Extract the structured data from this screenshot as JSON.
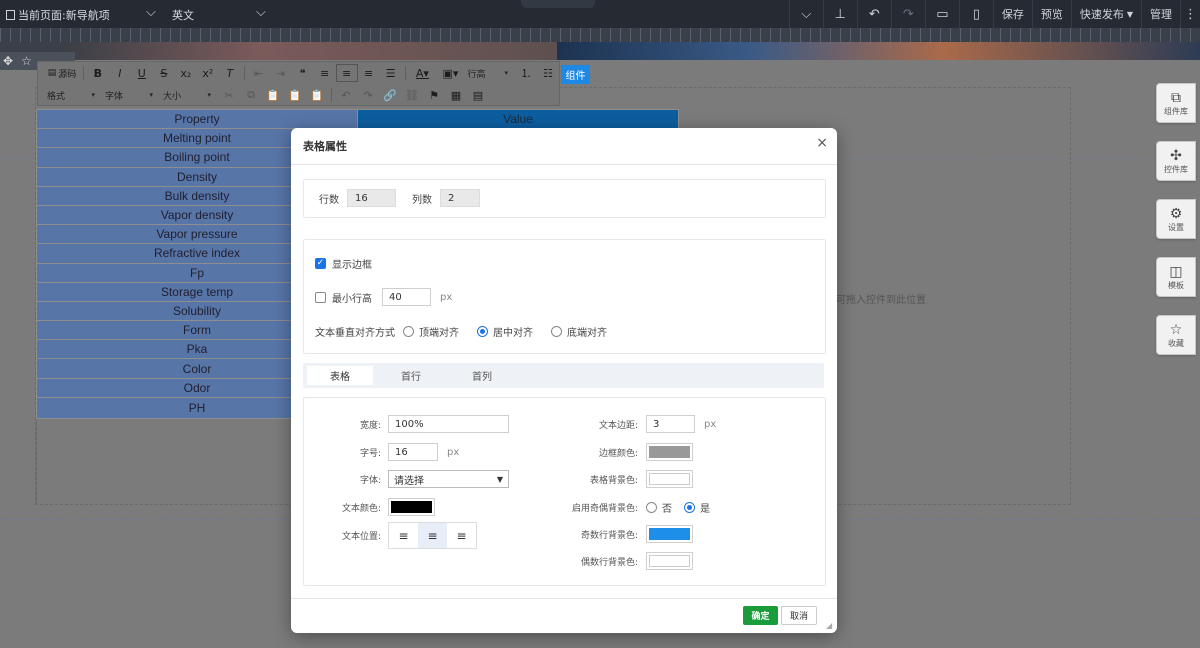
{
  "topbar": {
    "current_page": "当前页面:新导航项",
    "language": "英文",
    "buttons": {
      "save": "保存",
      "preview": "预览",
      "quick_publish": "快速发布",
      "manage": "管理"
    },
    "icons": [
      "chevron-down-icon",
      "align-bottom-icon",
      "undo-icon",
      "redo-icon",
      "desktop-icon",
      "mobile-icon"
    ]
  },
  "canvas": {
    "drop_hint": "可拖入控件到此位置",
    "add_component_label": "组件"
  },
  "editor_toolbar": {
    "source_label": "源码",
    "line_height_combo": "行高",
    "format_combo": "格式",
    "font_combo": "字体",
    "size_combo": "大小"
  },
  "table": {
    "header": [
      "Property",
      "Value"
    ],
    "rows": [
      "Melting point",
      "Boiling point",
      "Density",
      "Bulk density",
      "Vapor density",
      "Vapor pressure",
      "Refractive index",
      "Fp",
      "Storage temp",
      "Solubility",
      "Form",
      "Pka",
      "Color",
      "Odor",
      "PH"
    ]
  },
  "right_panel": [
    {
      "label": "组件库",
      "icon": "copy-icon"
    },
    {
      "label": "控件库",
      "icon": "puzzle-icon"
    },
    {
      "label": "设置",
      "icon": "gear-icon"
    },
    {
      "label": "模板",
      "icon": "layout-icon"
    },
    {
      "label": "收藏",
      "icon": "star-icon"
    }
  ],
  "modal": {
    "title": "表格属性",
    "rows_label": "行数",
    "rows_value": "16",
    "cols_label": "列数",
    "cols_value": "2",
    "show_border_label": "显示边框",
    "show_border_checked": true,
    "min_row_height_label": "最小行高",
    "min_row_height_checked": false,
    "min_row_height_value": "40",
    "px": "px",
    "valign_label": "文本垂直对齐方式",
    "valign_options": [
      "顶端对齐",
      "居中对齐",
      "底端对齐"
    ],
    "valign_selected": "居中对齐",
    "tabs": [
      "表格",
      "首行",
      "首列"
    ],
    "active_tab": "表格",
    "width_label": "宽度:",
    "width_value": "100%",
    "font_size_label": "字号:",
    "font_size_value": "16",
    "font_label": "字体:",
    "font_value": "请选择",
    "text_color_label": "文本颜色:",
    "text_color": "#000000",
    "text_position_label": "文本位置:",
    "padding_label": "文本边距:",
    "padding_value": "3",
    "border_color_label": "边框颜色:",
    "border_color": "#999999",
    "table_bg_label": "表格背景色:",
    "table_bg": "#ffffff",
    "zebra_label": "启用奇偶背景色:",
    "zebra_no": "否",
    "zebra_yes": "是",
    "zebra_enabled": true,
    "odd_bg_label": "奇数行背景色:",
    "odd_bg": "#1e8fe8",
    "even_bg_label": "偶数行背景色:",
    "even_bg": "#ffffff",
    "ok": "确定",
    "cancel": "取消"
  }
}
